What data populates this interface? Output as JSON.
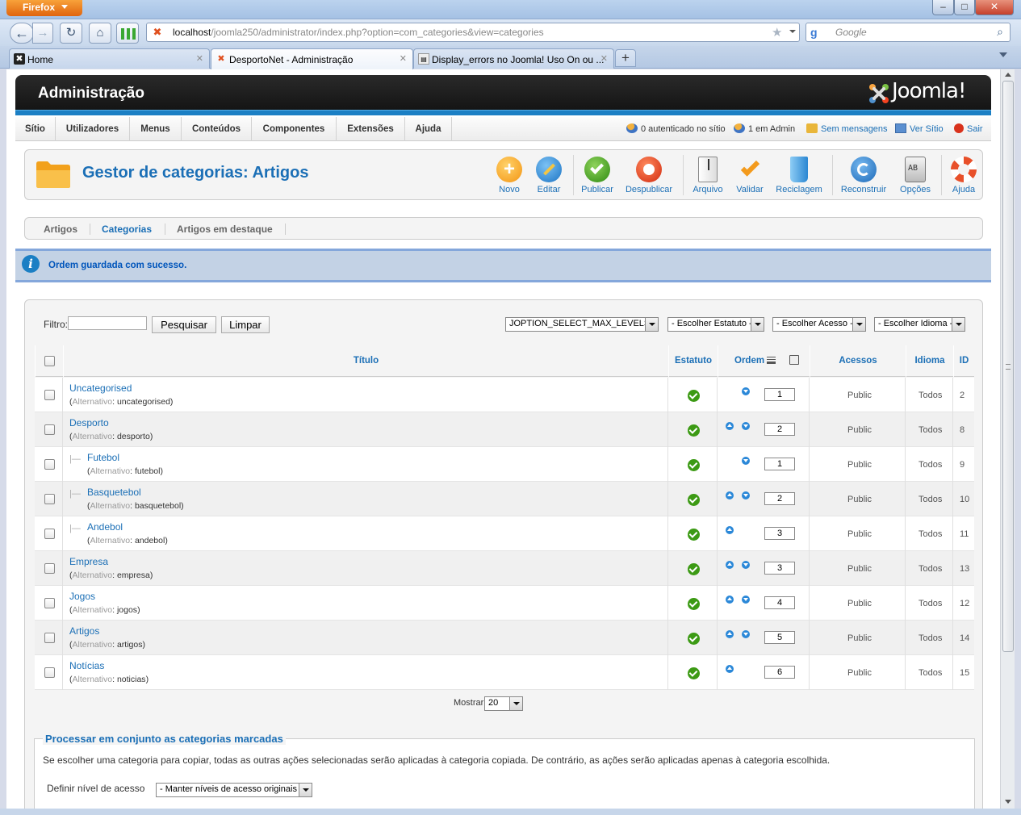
{
  "browser": {
    "menu_button": "Firefox",
    "url_host": "localhost",
    "url_path": "/joomla250/administrator/index.php?option=com_categories&view=categories",
    "search_placeholder": "Google",
    "tabs": [
      {
        "label": "Home",
        "active": false
      },
      {
        "label": "DesportoNet - Administração",
        "active": true
      },
      {
        "label": "Display_errors no Joomla! Uso On ou ...",
        "active": false
      }
    ]
  },
  "header": {
    "title": "Administração",
    "logo_text": "Joomla!"
  },
  "menu": {
    "items": [
      "Sítio",
      "Utilizadores",
      "Menus",
      "Conteúdos",
      "Componentes",
      "Extensões",
      "Ajuda"
    ],
    "status": {
      "logged_in": "0 autenticado no sítio",
      "admin": "1 em Admin",
      "messages": "Sem mensagens",
      "view_site": "Ver Sítio",
      "logout": "Sair"
    }
  },
  "toolbar": {
    "page_title": "Gestor de categorias: Artigos",
    "buttons": [
      {
        "label": "Novo",
        "icon": "new-icon",
        "color": "#f7a51a"
      },
      {
        "label": "Editar",
        "icon": "edit-icon",
        "color": "#2b8ad6"
      },
      {
        "label": "Publicar",
        "icon": "publish-icon",
        "color": "#3c9a14"
      },
      {
        "label": "Despublicar",
        "icon": "unpublish-icon",
        "color": "#e1421c"
      },
      {
        "label": "Arquivo",
        "icon": "archive-icon",
        "color": "#888888"
      },
      {
        "label": "Validar",
        "icon": "checkin-icon",
        "color": "#f39a1c"
      },
      {
        "label": "Reciclagem",
        "icon": "trash-icon",
        "color": "#2b8ad6"
      },
      {
        "label": "Reconstruir",
        "icon": "refresh-icon",
        "color": "#2b8ad6"
      },
      {
        "label": "Opções",
        "icon": "options-icon",
        "color": "#777777"
      },
      {
        "label": "Ajuda",
        "icon": "help-icon",
        "color": "#e05a1c"
      }
    ]
  },
  "submenu": {
    "items": [
      "Artigos",
      "Categorias",
      "Artigos em destaque"
    ],
    "active": "Categorias"
  },
  "message": {
    "text": "Ordem guardada com sucesso."
  },
  "filters": {
    "filter_label": "Filtro:",
    "filter_value": "",
    "search_button": "Pesquisar",
    "clear_button": "Limpar",
    "max_levels": "JOPTION_SELECT_MAX_LEVELS",
    "status": "- Escolher Estatuto -",
    "access": "- Escolher Acesso -",
    "language": "- Escolher Idioma -"
  },
  "table": {
    "columns": {
      "title": "Título",
      "status": "Estatuto",
      "order": "Ordem",
      "access": "Acessos",
      "language": "Idioma",
      "id": "ID"
    },
    "alias_label": "Alternativo",
    "rows": [
      {
        "title": "Uncategorised",
        "alias": "uncategorised",
        "level": 1,
        "up": false,
        "down": true,
        "order": "1",
        "access": "Public",
        "language": "Todos",
        "id": "2"
      },
      {
        "title": "Desporto",
        "alias": "desporto",
        "level": 1,
        "up": true,
        "down": true,
        "order": "2",
        "access": "Public",
        "language": "Todos",
        "id": "8"
      },
      {
        "title": "Futebol",
        "alias": "futebol",
        "level": 2,
        "up": false,
        "down": true,
        "order": "1",
        "access": "Public",
        "language": "Todos",
        "id": "9"
      },
      {
        "title": "Basquetebol",
        "alias": "basquetebol",
        "level": 2,
        "up": true,
        "down": true,
        "order": "2",
        "access": "Public",
        "language": "Todos",
        "id": "10"
      },
      {
        "title": "Andebol",
        "alias": "andebol",
        "level": 2,
        "up": true,
        "down": false,
        "order": "3",
        "access": "Public",
        "language": "Todos",
        "id": "11"
      },
      {
        "title": "Empresa",
        "alias": "empresa",
        "level": 1,
        "up": true,
        "down": true,
        "order": "3",
        "access": "Public",
        "language": "Todos",
        "id": "13"
      },
      {
        "title": "Jogos",
        "alias": "jogos",
        "level": 1,
        "up": true,
        "down": true,
        "order": "4",
        "access": "Public",
        "language": "Todos",
        "id": "12"
      },
      {
        "title": "Artigos",
        "alias": "artigos",
        "level": 1,
        "up": true,
        "down": true,
        "order": "5",
        "access": "Public",
        "language": "Todos",
        "id": "14"
      },
      {
        "title": "Notícias",
        "alias": "noticias",
        "level": 1,
        "up": true,
        "down": false,
        "order": "6",
        "access": "Public",
        "language": "Todos",
        "id": "15"
      }
    ]
  },
  "pagination": {
    "show_label": "Mostrar",
    "show_value": "20"
  },
  "batch": {
    "legend": "Processar em conjunto as categorias marcadas",
    "description": "Se escolher uma categoria para copiar, todas as outras ações selecionadas serão aplicadas à categoria copiada. De contrário, as ações serão aplicadas apenas à categoria escolhida.",
    "access_label": "Definir nível de acesso",
    "access_value": "- Manter níveis de acesso originais -"
  }
}
